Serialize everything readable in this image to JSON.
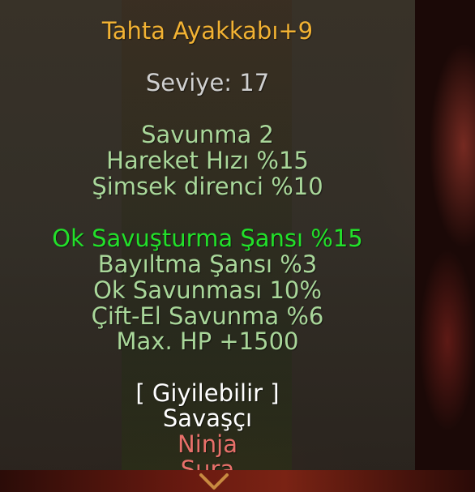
{
  "item": {
    "name": "Tahta Ayakkabı+9",
    "level": "Seviye: 17"
  },
  "base_stats": [
    "Savunma 2",
    "Hareket Hızı %15",
    "Şimsek direnci %10"
  ],
  "bonuses": {
    "highlighted": "Ok Savuşturma Şansı %15",
    "others": [
      "Bayıltma Şansı %3",
      "Ok Savunması 10%",
      "Çift-El Savunma %6",
      "Max. HP +1500"
    ]
  },
  "wearable": {
    "label": "[ Giyilebilir ]",
    "classes_allowed": [
      "Savaşçı"
    ],
    "classes_denied": [
      "Ninja",
      "Sura"
    ]
  },
  "colors": {
    "title": "#f2b233",
    "level": "#d0d0d0",
    "stat": "#a9d79a",
    "bonus_highlight": "#22e02a",
    "allowed": "#ffffff",
    "denied": "#e8706a"
  },
  "icons": {
    "scroll_indicator": "chevron-down-icon"
  }
}
